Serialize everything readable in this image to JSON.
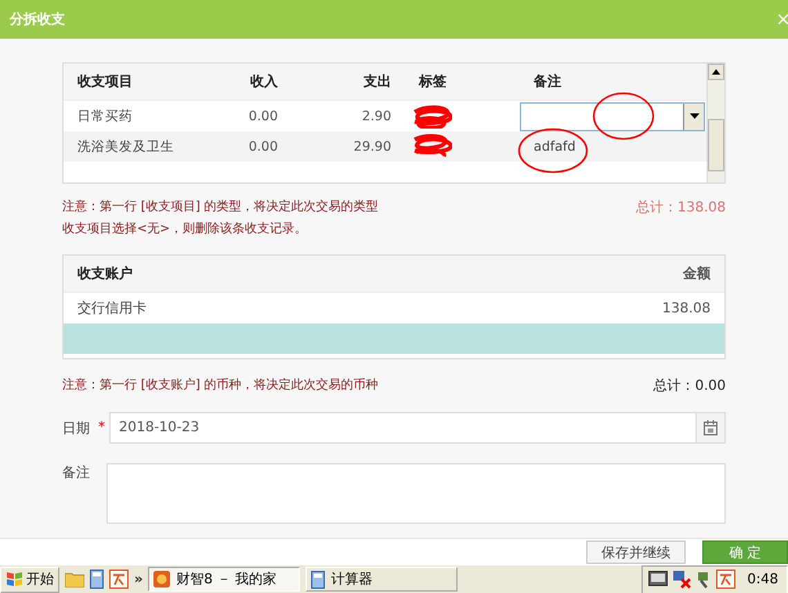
{
  "window": {
    "title": "分拆收支",
    "close": "×"
  },
  "items_table": {
    "columns": [
      "收支项目",
      "收入",
      "支出",
      "标签",
      "备注"
    ],
    "rows": [
      {
        "item": "日常买药",
        "income": "0.00",
        "expense": "2.90",
        "memo": "",
        "kind": "dropdown"
      },
      {
        "item": "洗浴美发及卫生",
        "income": "0.00",
        "expense": "29.90",
        "memo": "adfafd",
        "kind": "text"
      }
    ]
  },
  "items_note": [
    "注意：第一行 [收支项目] 的类型，将决定此次交易的类型",
    "收支项目选择<无>，则删除该条收支记录。"
  ],
  "items_total": "总计：138.08",
  "accounts_table": {
    "columns": [
      "收支账户",
      "金额"
    ],
    "rows": [
      {
        "account": "交行信用卡",
        "amount": "138.08",
        "selected": false
      },
      {
        "account": "",
        "amount": "",
        "selected": true
      }
    ]
  },
  "accounts_note": "注意：第一行 [收支账户] 的币种，将决定此次交易的币种",
  "accounts_total": "总计：0.00",
  "date": {
    "label": "日期",
    "required_mark": "*",
    "value": "2018-10-23"
  },
  "memo": {
    "label": "备注"
  },
  "buttons": [
    {
      "label": "保存并继续",
      "kind": "secondary"
    },
    {
      "label": "确 定",
      "kind": "primary"
    }
  ],
  "taskbar": {
    "start": "开始",
    "more": "»",
    "tasks": [
      {
        "label": "财智8 － 我的家",
        "selected": true
      },
      {
        "label": "计算器",
        "selected": false
      }
    ],
    "clock": "0:48"
  }
}
